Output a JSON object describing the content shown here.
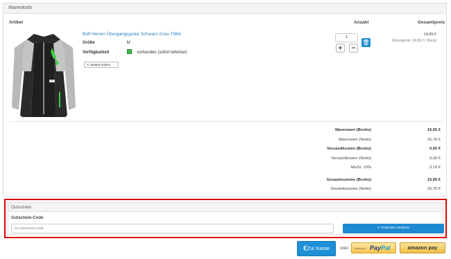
{
  "cart": {
    "title": "Warenkorb",
    "columns": {
      "artikel": "Artikel",
      "anzahl": "Anzahl",
      "gesamtpreis": "Gesamtpreis"
    },
    "item": {
      "name": "Bolf Herren Übergangsjacke Schwarz-Grau T864",
      "size_label": "Größe",
      "size_value": "M",
      "availability_label": "Verfügbarkeit",
      "availability_value": "vorhanden (sofort lieferbar)",
      "edit_label": "Variante ändern",
      "quantity": "1",
      "price": "19,95 €",
      "unit_price": "(Grundpreis: 19,95 € / Stück)"
    },
    "totals": [
      {
        "label": "Warenwert (Brutto)",
        "value": "19,95 €",
        "bold": true
      },
      {
        "label": "Warenwert (Netto)",
        "value": "16,76 €",
        "bold": false
      },
      {
        "label": "Versandkosten (Brutto)",
        "value": "0,00 €",
        "bold": true
      },
      {
        "label": "Versandkosten (Netto)",
        "value": "0,00 €",
        "bold": false
      },
      {
        "label": "MwSt. 19%",
        "value": "3,19 €",
        "bold": false
      },
      {
        "label": "Gesamtsumme (Brutto)",
        "value": "19,95 €",
        "bold": true
      },
      {
        "label": "Gesamtsumme (Netto)",
        "value": "16,76 €",
        "bold": false
      }
    ]
  },
  "coupon": {
    "title": "Gutschein",
    "field_label": "Gutschein-Code",
    "placeholder": "Ihr Gutschein-Code",
    "button_label": "Gutschein einlösen"
  },
  "checkout": {
    "button_label": "Zur Kasse",
    "or_text": "oder",
    "paypal_prefix": "Direkt zu",
    "paypal_word_1": "Pay",
    "paypal_word_2": "Pal",
    "amazon_label": "amazon pay"
  },
  "colors": {
    "accent": "#1e8fd0",
    "highlight_border": "#e00000",
    "available": "#3cb44b"
  }
}
